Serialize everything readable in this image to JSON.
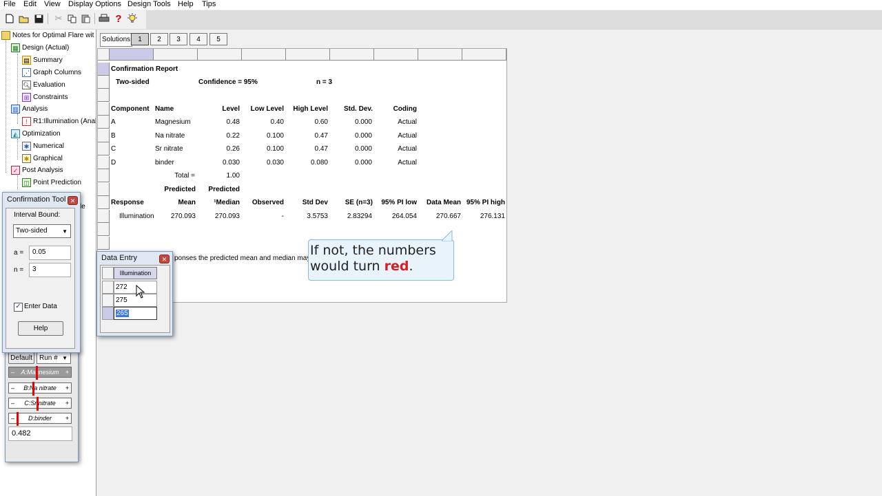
{
  "menu": [
    "File",
    "Edit",
    "View",
    "Display Options",
    "Design Tools",
    "Help",
    "Tips"
  ],
  "toolbar_icons": [
    "new-file-icon",
    "open-folder-icon",
    "save-icon",
    "cut-icon",
    "copy-icon",
    "paste-icon",
    "print-icon",
    "help-icon",
    "tips-lightbulb-icon"
  ],
  "tree": {
    "root": "Notes for Optimal Flare wit",
    "design": "Design (Actual)",
    "summary": "Summary",
    "graph_columns": "Graph Columns",
    "evaluation": "Evaluation",
    "constraints": "Constraints",
    "analysis": "Analysis",
    "r1": "R1:Illumination (Anal",
    "optimization": "Optimization",
    "numerical": "Numerical",
    "graphical": "Graphical",
    "post_analysis": "Post Analysis",
    "point_prediction": "Point Prediction"
  },
  "solutions": {
    "label": "Solutions",
    "buttons": [
      "1",
      "2",
      "3",
      "4",
      "5"
    ]
  },
  "report": {
    "title": "Confirmation Report",
    "two_sided": "Two-sided",
    "confidence": "Confidence = 95%",
    "n": "n =  3",
    "headers": [
      "Component",
      "Name",
      "Level",
      "Low Level",
      "High Level",
      "Std. Dev.",
      "Coding"
    ],
    "components": [
      [
        "A",
        "Magnesium",
        "0.48",
        "0.40",
        "0.60",
        "0.000",
        "Actual"
      ],
      [
        "B",
        "Na nitrate",
        "0.22",
        "0.100",
        "0.47",
        "0.000",
        "Actual"
      ],
      [
        "C",
        "Sr nitrate",
        "0.26",
        "0.100",
        "0.47",
        "0.000",
        "Actual"
      ],
      [
        "D",
        "binder",
        "0.030",
        "0.030",
        "0.080",
        "0.000",
        "Actual"
      ]
    ],
    "total_label": "Total =",
    "total_value": "1.00",
    "predicted1": "Predicted",
    "predicted2": "Predicted",
    "resp_headers": [
      "Response",
      "Mean",
      "¹Median",
      "Observed",
      "Std Dev",
      "SE (n=3)",
      "95% PI low",
      "Data Mean",
      "95% PI high"
    ],
    "resp_row": [
      "Illumination",
      "270.093",
      "270.093",
      "-",
      "3.5753",
      "2.83294",
      "264.054",
      "270.667",
      "276.131"
    ],
    "footnote": "ponses the predicted mean and median may d"
  },
  "callout": {
    "line1": "If not, the numbers",
    "line2a": "would turn ",
    "line2b": "red",
    "line2c": "."
  },
  "conf_tool": {
    "title": "Confirmation Tool",
    "interval_label": "Interval Bound:",
    "interval_value": "Two-sided",
    "alpha_label": "a =",
    "alpha_value": "0.05",
    "n_label": "n =",
    "n_value": "3",
    "enter_data": "Enter Data",
    "help": "Help"
  },
  "factor_panel": {
    "default": "Default",
    "run": "Run #",
    "sliders": [
      {
        "label": "A:Magnesium",
        "fraction": 0.4
      },
      {
        "label": "B:Na nitrate",
        "fraction": 0.33
      },
      {
        "label": "C:Sr nitrate",
        "fraction": 0.43
      },
      {
        "label": "D:binder",
        "fraction": 0.0
      }
    ],
    "value": "0.482"
  },
  "data_entry": {
    "title": "Data Entry",
    "column": "Illumination",
    "values": [
      "272",
      "275",
      "265"
    ]
  },
  "peek_text": "le"
}
